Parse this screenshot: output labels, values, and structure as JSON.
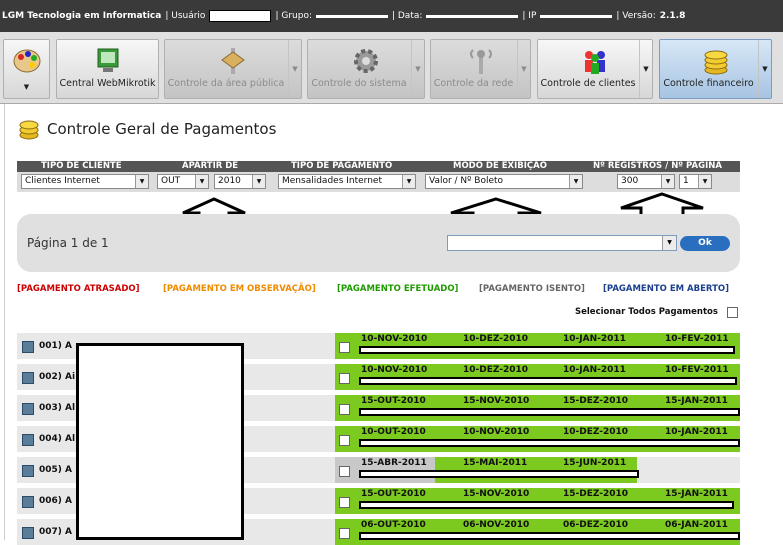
{
  "topbar": {
    "app_name": "LGM Tecnologia em Informatica",
    "user_label": "| Usuário",
    "group_label": "| Grupo:",
    "date_label": "| Data:",
    "ip_label": "| IP",
    "version_label": "| Versão:",
    "version_value": "2.1.8"
  },
  "toolbar": {
    "buttons": [
      {
        "label": "",
        "icon": "palette-icon"
      },
      {
        "label": "Central WebMikrotik",
        "icon": "monitor-icon"
      },
      {
        "label": "Controle da área pública",
        "icon": "public-area-icon"
      },
      {
        "label": "Controle do sistema",
        "icon": "gear-icon"
      },
      {
        "label": "Controle da rede",
        "icon": "antenna-icon"
      },
      {
        "label": "Controle de clientes",
        "icon": "people-icon"
      },
      {
        "label": "Controle financeiro",
        "icon": "coins-icon"
      }
    ]
  },
  "page": {
    "title": "Controle Geral de Pagamentos"
  },
  "filters": {
    "headers": {
      "tipo_cliente": "TIPO DE CLIENTE",
      "apartir": "APARTIR DE",
      "tipo_pagamento": "TIPO DE PAGAMENTO",
      "modo": "MODO DE EXIBIÇÃO",
      "registros": "Nº REGISTROS / Nº PÁGINA"
    },
    "values": {
      "tipo_cliente": "Clientes Internet",
      "mes": "OUT",
      "ano": "2010",
      "tipo_pagamento": "Mensalidades Internet",
      "modo": "Valor / Nº Boleto",
      "registros": "300",
      "pagina": "1"
    }
  },
  "pager": {
    "text": "Página 1 de 1",
    "ok_label": "Ok"
  },
  "legend": [
    {
      "label": "[PAGAMENTO ATRASADO]",
      "color": "#cc0000"
    },
    {
      "label": "[PAGAMENTO EM OBSERVAÇÃO]",
      "color": "#f08a00"
    },
    {
      "label": "[PAGAMENTO EFETUADO]",
      "color": "#1f9a00"
    },
    {
      "label": "[PAGAMENTO ISENTO]",
      "color": "#666666"
    },
    {
      "label": "[PAGAMENTO EM ABERTO]",
      "color": "#1a3f8f"
    }
  ],
  "select_all_label": "Selecionar Todos Pagamentos",
  "rows": [
    {
      "num": "001) A",
      "dates": [
        "10-NOV-2010",
        "10-DEZ-2010",
        "10-JAN-2011",
        "10-FEV-2011"
      ]
    },
    {
      "num": "002) Ai",
      "dates": [
        "10-NOV-2010",
        "10-DEZ-2010",
        "10-JAN-2011",
        "10-FEV-2011"
      ]
    },
    {
      "num": "003) Al",
      "dates": [
        "15-OUT-2010",
        "15-NOV-2010",
        "15-DEZ-2010",
        "15-JAN-2011"
      ]
    },
    {
      "num": "004) Al",
      "dates": [
        "10-OUT-2010",
        "10-NOV-2010",
        "10-DEZ-2010",
        "10-JAN-2011"
      ]
    },
    {
      "num": "005) A",
      "dates": [
        "15-ABR-2011",
        "15-MAI-2011",
        "15-JUN-2011"
      ]
    },
    {
      "num": "006) A",
      "dates": [
        "15-OUT-2010",
        "15-NOV-2010",
        "15-DEZ-2010",
        "15-JAN-2011"
      ]
    },
    {
      "num": "007) A",
      "dates": [
        "06-OUT-2010",
        "06-NOV-2010",
        "06-DEZ-2010",
        "06-JAN-2011"
      ]
    }
  ]
}
